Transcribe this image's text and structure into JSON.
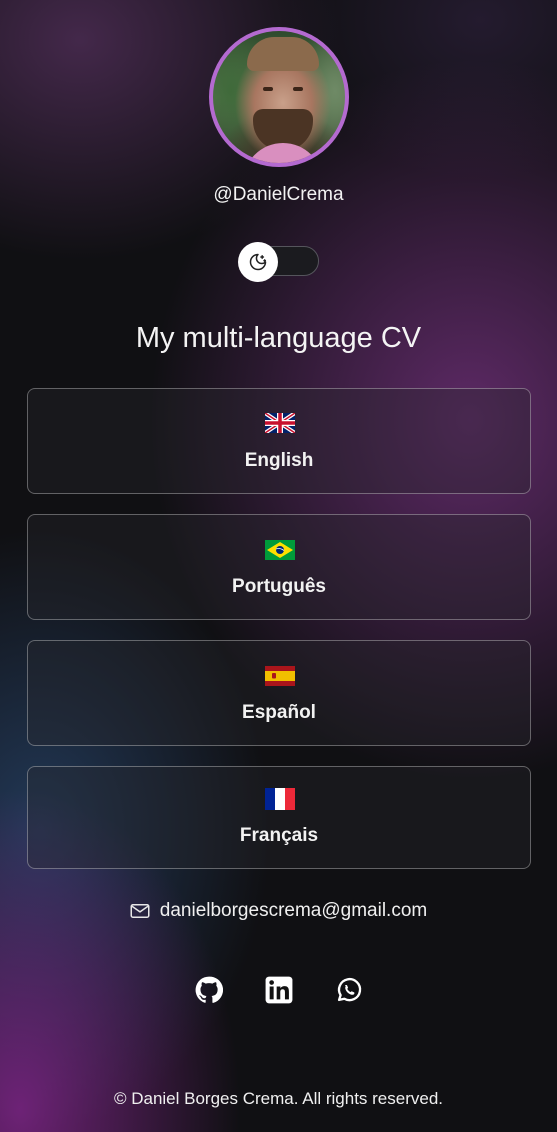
{
  "profile": {
    "username": "@DanielCrema"
  },
  "theme_toggle": {
    "icon": "moon-stars-icon"
  },
  "heading": "My multi-language CV",
  "languages": [
    {
      "label": "English",
      "flag": "uk-flag-icon"
    },
    {
      "label": "Português",
      "flag": "brazil-flag-icon"
    },
    {
      "label": "Español",
      "flag": "spain-flag-icon"
    },
    {
      "label": "Français",
      "flag": "france-flag-icon"
    }
  ],
  "contact": {
    "email": "danielborgescrema@gmail.com",
    "icon": "mail-icon"
  },
  "social": [
    {
      "name": "github-icon"
    },
    {
      "name": "linkedin-icon"
    },
    {
      "name": "whatsapp-icon"
    }
  ],
  "footer": "© Daniel Borges Crema. All rights reserved.",
  "colors": {
    "background": "#101013",
    "avatar_border": "#b46ad0",
    "accent_glow": "#8c2896"
  }
}
